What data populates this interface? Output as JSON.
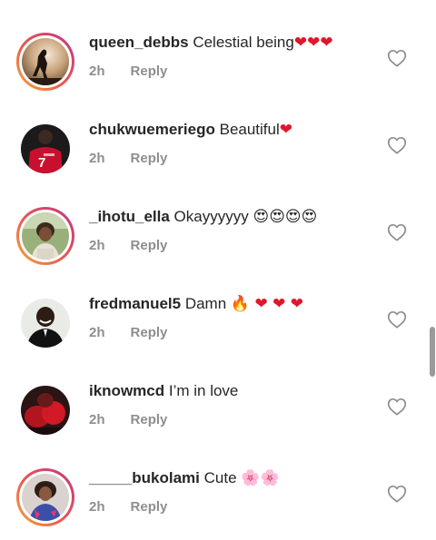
{
  "comments": [
    {
      "username": "queen_debbs",
      "text": "Celestial being",
      "emoji": "❤❤❤",
      "time": "2h",
      "reply_label": "Reply",
      "avatar": "silhouette-sunset",
      "ring": true
    },
    {
      "username": "chukwuemeriego",
      "text": "Beautiful",
      "emoji": "❤",
      "time": "2h",
      "reply_label": "Reply",
      "avatar": "red-jersey-7",
      "ring": false
    },
    {
      "username": "_ihotu_ella",
      "text": "Okayyyyyy",
      "emoji": "😍😍😍😍",
      "time": "2h",
      "reply_label": "Reply",
      "avatar": "woman-outdoors",
      "ring": true
    },
    {
      "username": "fredmanuel5",
      "text": "Damn",
      "emoji": "🔥 ❤ ❤ ❤",
      "time": "2h",
      "reply_label": "Reply",
      "avatar": "man-smiling",
      "ring": false
    },
    {
      "username": "iknowmcd",
      "text": "I’m in love",
      "emoji": "",
      "time": "2h",
      "reply_label": "Reply",
      "avatar": "red-dark-photo",
      "ring": false
    },
    {
      "username": "_____bukolami",
      "text": "Cute",
      "emoji": "🌸🌸",
      "time": "2h",
      "reply_label": "Reply",
      "avatar": "woman-portrait",
      "ring": true
    }
  ],
  "colors": {
    "text": "#262626",
    "meta": "#8e8e8e",
    "heart_outline": "#8e8e8e",
    "emoji_heart": "#e0162b"
  },
  "icons": {
    "like": "heart-outline-icon"
  }
}
